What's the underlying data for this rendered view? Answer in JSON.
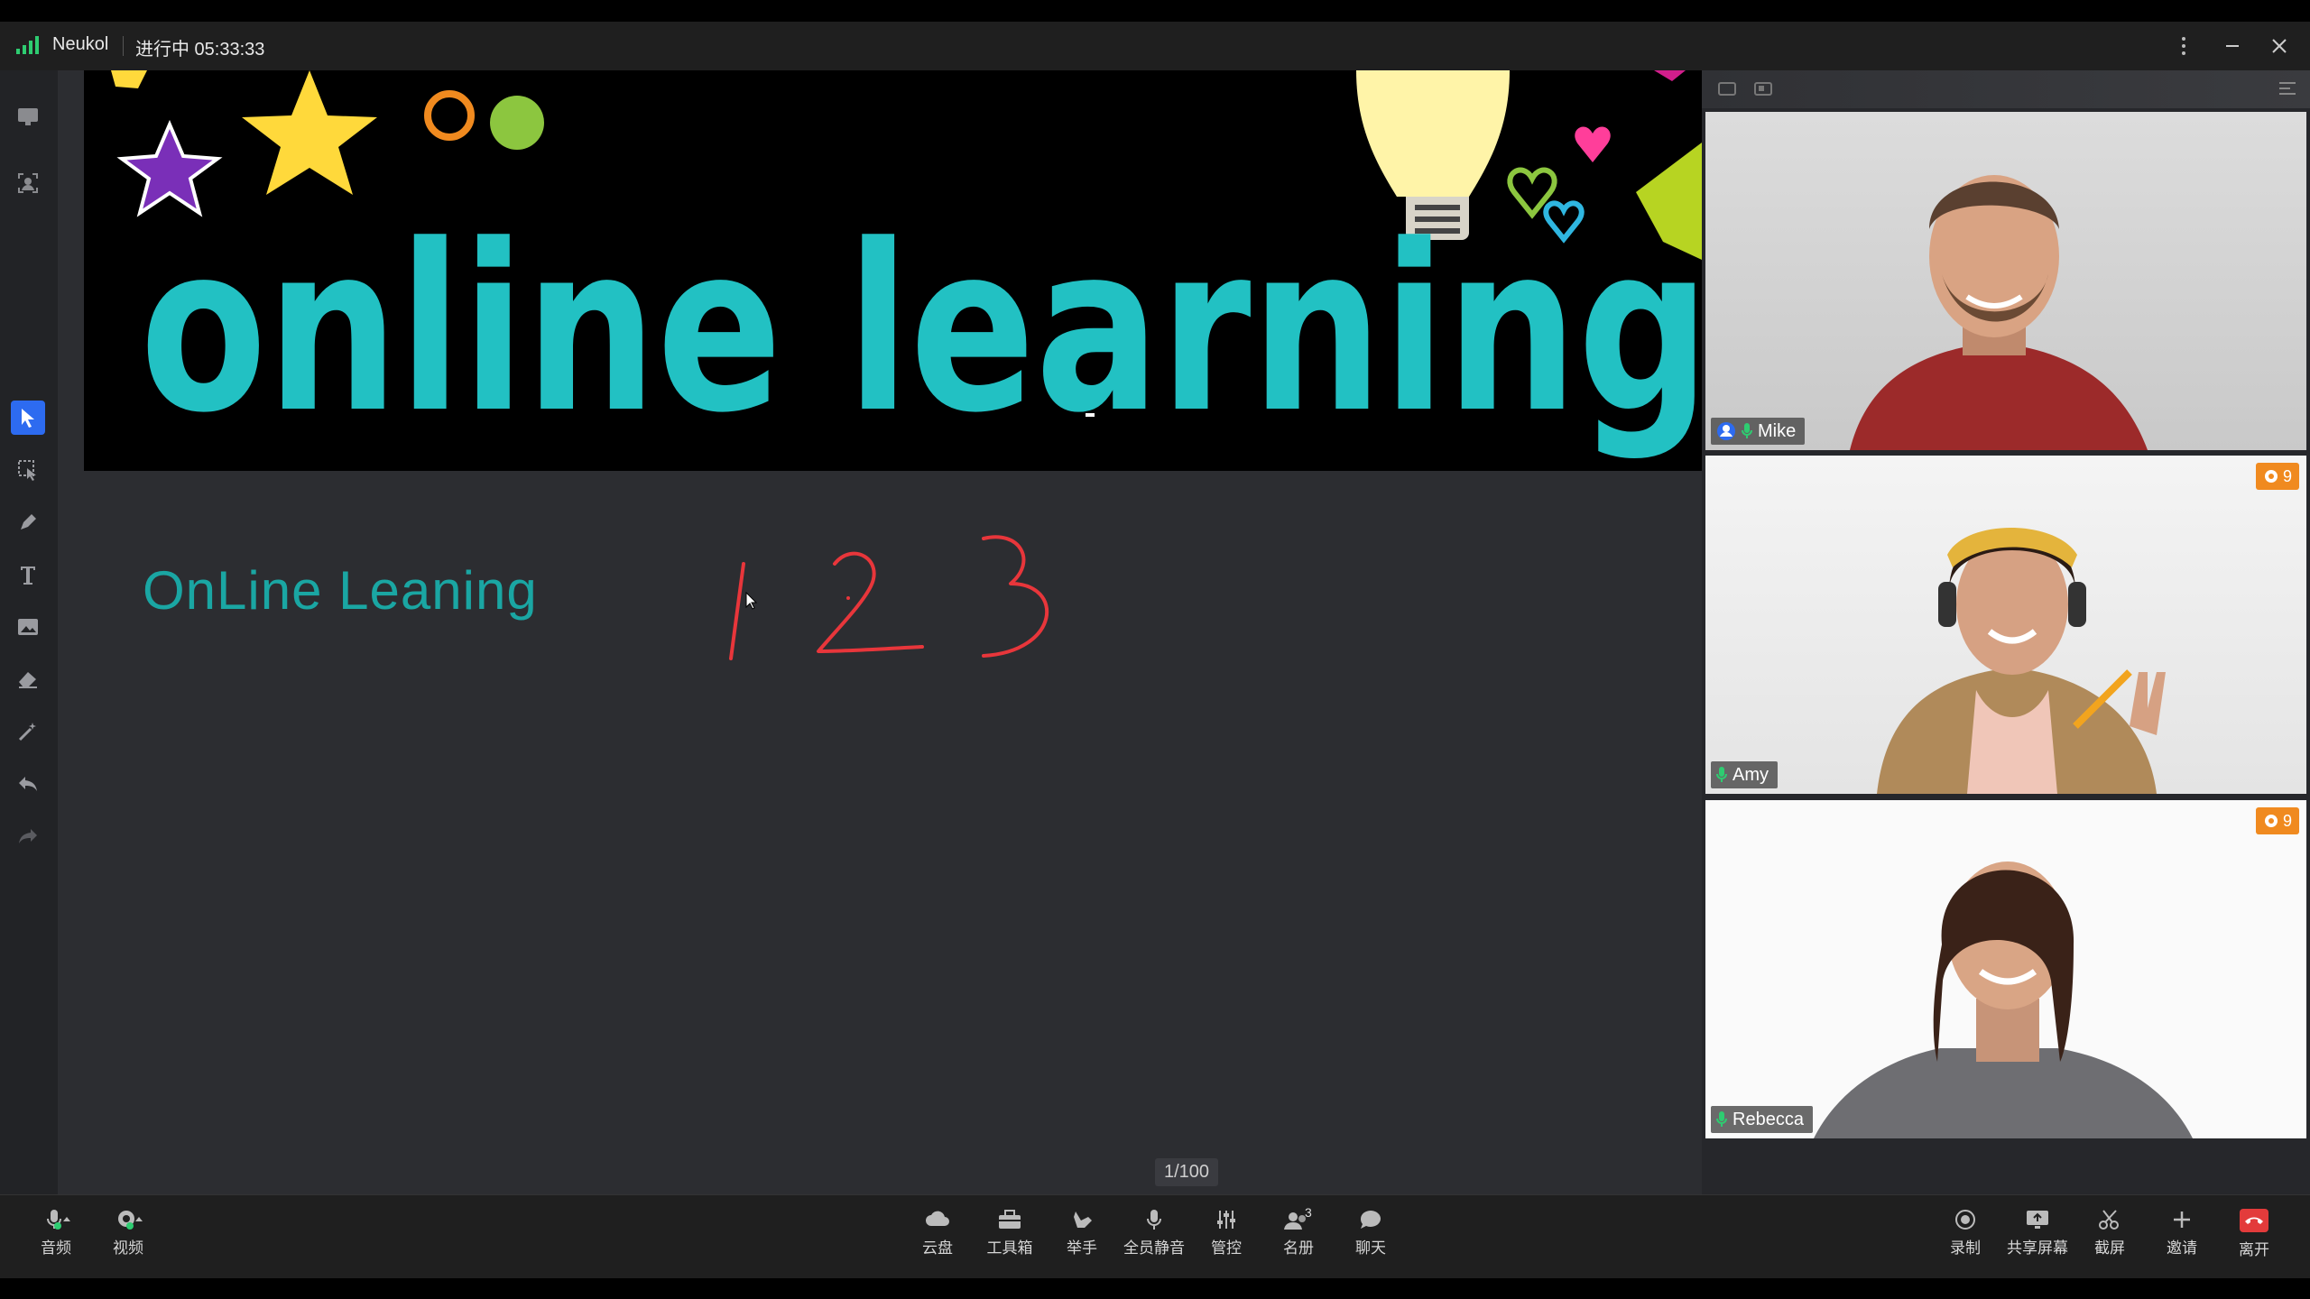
{
  "titlebar": {
    "app_name": "Neukol",
    "status": "进行中 05:33:33"
  },
  "board": {
    "banner_text": "online learning",
    "note_text": "OnLine Leaning",
    "handwritten": [
      "1",
      "2",
      "3"
    ],
    "page": "1/100"
  },
  "participants": [
    {
      "name": "Mike",
      "is_host": true,
      "reward": ""
    },
    {
      "name": "Amy",
      "is_host": false,
      "reward": "9"
    },
    {
      "name": "Rebecca",
      "is_host": false,
      "reward": "9"
    }
  ],
  "bottom_left": [
    {
      "label": "音频",
      "icon": "mic-icon"
    },
    {
      "label": "视频",
      "icon": "camera-icon"
    }
  ],
  "bottom_center": [
    {
      "label": "云盘",
      "icon": "cloud-icon"
    },
    {
      "label": "工具箱",
      "icon": "toolbox-icon"
    },
    {
      "label": "举手",
      "icon": "raise-hand-icon"
    },
    {
      "label": "全员静音",
      "icon": "mute-all-icon"
    },
    {
      "label": "管控",
      "icon": "sliders-icon"
    },
    {
      "label": "名册",
      "icon": "roster-icon",
      "badge": "3"
    },
    {
      "label": "聊天",
      "icon": "chat-icon"
    }
  ],
  "bottom_right": [
    {
      "label": "录制",
      "icon": "record-icon"
    },
    {
      "label": "共享屏幕",
      "icon": "share-screen-icon"
    },
    {
      "label": "截屏",
      "icon": "scissors-icon"
    },
    {
      "label": "邀请",
      "icon": "plus-icon"
    },
    {
      "label": "离开",
      "icon": "hangup-icon"
    }
  ],
  "colors": {
    "accent": "#2d6bf0",
    "note": "#1aa6a3",
    "ink": "#e8363b",
    "reward": "#f08a1f",
    "leave": "#e33b3b"
  }
}
